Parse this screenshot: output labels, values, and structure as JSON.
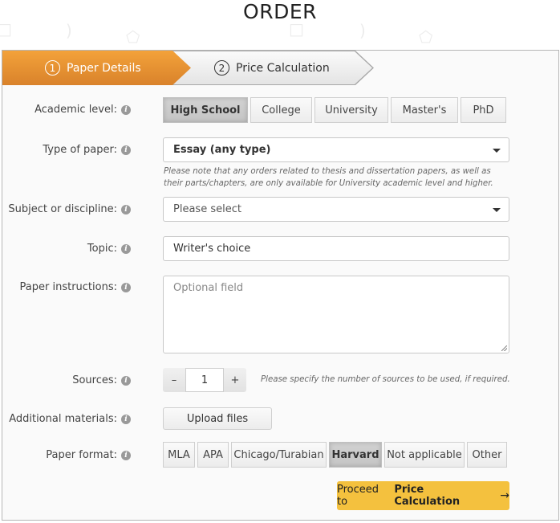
{
  "page": {
    "title": "ORDER"
  },
  "steps": [
    {
      "number": "1",
      "label": "Paper Details",
      "active": true
    },
    {
      "number": "2",
      "label": "Price Calculation",
      "active": false
    }
  ],
  "colors": {
    "active_step": "#e8922f",
    "proceed_button": "#f4c13e",
    "selected_option": "#c9c9c9"
  },
  "form": {
    "academic_level": {
      "label": "Academic level:",
      "options": [
        "High School",
        "College",
        "University",
        "Master's",
        "PhD"
      ],
      "selected": "High School"
    },
    "type_of_paper": {
      "label": "Type of paper:",
      "value": "Essay (any type)",
      "note": "Please note that any orders related to thesis and dissertation papers, as well as their parts/chapters, are only available for University academic level and higher."
    },
    "subject": {
      "label": "Subject or discipline:",
      "value": "Please select"
    },
    "topic": {
      "label": "Topic:",
      "value": "Writer's choice"
    },
    "instructions": {
      "label": "Paper instructions:",
      "placeholder": "Optional field"
    },
    "sources": {
      "label": "Sources:",
      "value": "1",
      "minus": "–",
      "plus": "+",
      "hint": "Please specify the number of sources to be used, if required."
    },
    "additional_materials": {
      "label": "Additional materials:",
      "button": "Upload files"
    },
    "paper_format": {
      "label": "Paper format:",
      "options": [
        "MLA",
        "APA",
        "Chicago/Turabian",
        "Harvard",
        "Not applicable",
        "Other"
      ],
      "selected": "Harvard"
    },
    "proceed": {
      "prefix": "Proceed to",
      "bold": "Price Calculation",
      "arrow": "→"
    }
  }
}
